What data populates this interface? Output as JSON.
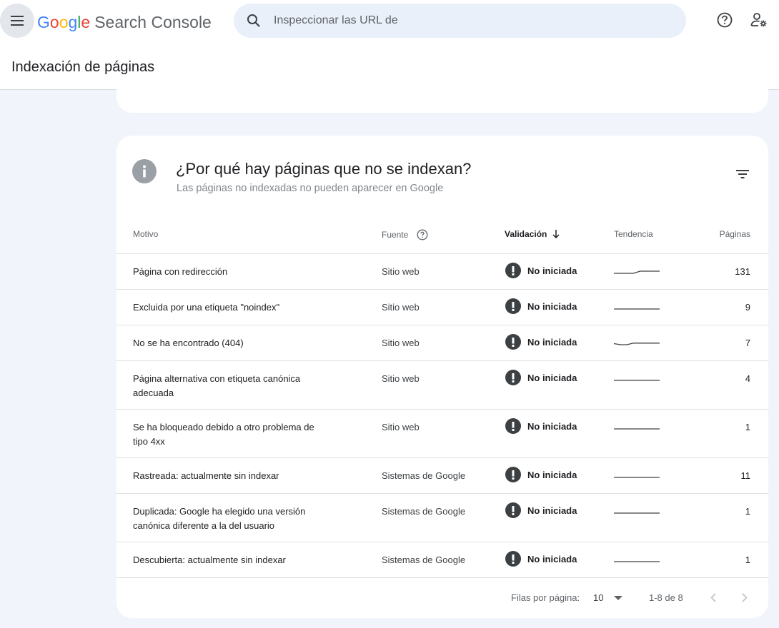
{
  "header": {
    "logo_letters": [
      {
        "char": "G",
        "color": "#4285F4"
      },
      {
        "char": "o",
        "color": "#EA4335"
      },
      {
        "char": "o",
        "color": "#FBBC05"
      },
      {
        "char": "g",
        "color": "#4285F4"
      },
      {
        "char": "l",
        "color": "#34A853"
      },
      {
        "char": "e",
        "color": "#EA4335"
      }
    ],
    "product_name": "Search Console",
    "search_placeholder": "Inspeccionar las URL de",
    "icons": [
      "menu-icon",
      "search-icon",
      "help-icon",
      "manage-users-icon"
    ]
  },
  "page": {
    "title": "Indexación de páginas"
  },
  "card": {
    "title": "¿Por qué hay páginas que no se indexan?",
    "subtitle": "Las páginas no indexadas no pueden aparecer en Google",
    "icons": [
      "info-icon",
      "filter-icon"
    ],
    "columns": {
      "motivo": "Motivo",
      "fuente": "Fuente",
      "validacion": "Validación",
      "tendencia": "Tendencia",
      "paginas": "Páginas"
    },
    "rows": [
      {
        "motivo": "Página con redirección",
        "fuente": "Sitio web",
        "validacion": "No iniciada",
        "paginas": "131",
        "trend": [
          1,
          1,
          1,
          1,
          1.4,
          1.4,
          1.4,
          1.4
        ]
      },
      {
        "motivo": "Excluida por una etiqueta \"noindex\"",
        "fuente": "Sitio web",
        "validacion": "No iniciada",
        "paginas": "9",
        "trend": [
          1,
          1,
          1,
          1,
          1,
          1,
          1,
          1
        ]
      },
      {
        "motivo": "No se ha encontrado (404)",
        "fuente": "Sitio web",
        "validacion": "No iniciada",
        "paginas": "7",
        "trend": [
          1.2,
          1,
          1,
          1.3,
          1.3,
          1.3,
          1.3,
          1.3
        ]
      },
      {
        "motivo": "Página alternativa con etiqueta canónica adecuada",
        "fuente": "Sitio web",
        "validacion": "No iniciada",
        "paginas": "4",
        "trend": [
          1,
          1,
          1,
          1,
          1,
          1,
          1,
          1
        ]
      },
      {
        "motivo": "Se ha bloqueado debido a otro problema de tipo 4xx",
        "fuente": "Sitio web",
        "validacion": "No iniciada",
        "paginas": "1",
        "trend": [
          1,
          1,
          1,
          1,
          1,
          1,
          1,
          1
        ]
      },
      {
        "motivo": "Rastreada: actualmente sin indexar",
        "fuente": "Sistemas de Google",
        "validacion": "No iniciada",
        "paginas": "11",
        "trend": [
          1,
          1,
          1,
          1,
          1,
          1,
          1,
          1
        ]
      },
      {
        "motivo": "Duplicada: Google ha elegido una versión canónica diferente a la del usuario",
        "fuente": "Sistemas de Google",
        "validacion": "No iniciada",
        "paginas": "1",
        "trend": [
          1,
          1,
          1,
          1,
          1,
          1,
          1,
          1
        ]
      },
      {
        "motivo": "Descubierta: actualmente sin indexar",
        "fuente": "Sistemas de Google",
        "validacion": "No iniciada",
        "paginas": "1",
        "trend": [
          1,
          1,
          1,
          1,
          1,
          1,
          1,
          1
        ]
      }
    ],
    "footer": {
      "rows_per_page_label": "Filas por página:",
      "rows_per_page_value": "10",
      "range": "1-8 de 8"
    }
  },
  "colors": {
    "background": "#f1f4fb",
    "search_bg": "#eaf0fa",
    "status_icon": "#3c4043",
    "trend_line": "#3c4043"
  }
}
